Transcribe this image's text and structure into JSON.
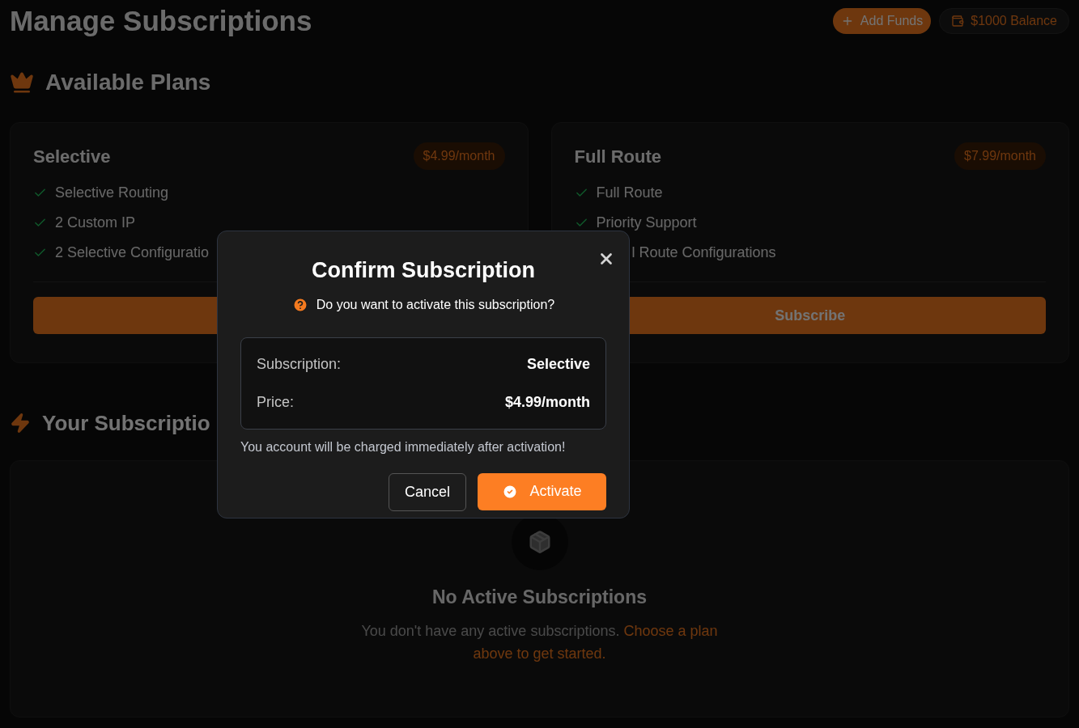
{
  "header": {
    "title": "Manage Subscriptions",
    "add_funds": "Add Funds",
    "balance": "$1000 Balance"
  },
  "plans_section": {
    "title": "Available Plans"
  },
  "plans": [
    {
      "name": "Selective",
      "price": "$4.99/month",
      "features": [
        "Selective Routing",
        "2 Custom IP",
        "2 Selective Configuratio"
      ]
    },
    {
      "name": "Full Route",
      "price": "$7.99/month",
      "features": [
        "Full Route",
        "Priority Support",
        {
          "kind": "partial",
          "text": "l Route Configurations"
        }
      ],
      "button": "Subscribe"
    }
  ],
  "subscriptions_section": {
    "title": "Your Subscriptio"
  },
  "empty_state": {
    "title": "No Active Subscriptions",
    "text": "You don't have any active subscriptions.",
    "link": "Choose a plan above to get started."
  },
  "dialog": {
    "title": "Confirm Subscription",
    "question": "Do you want to activate this subscription?",
    "rows": [
      {
        "label": "Subscription:",
        "value": "Selective"
      },
      {
        "label": "Price:",
        "value": "$4.99/month"
      }
    ],
    "warning": "You account will be charged immediately after activation!",
    "cancel": "Cancel",
    "confirm": "Activate"
  }
}
